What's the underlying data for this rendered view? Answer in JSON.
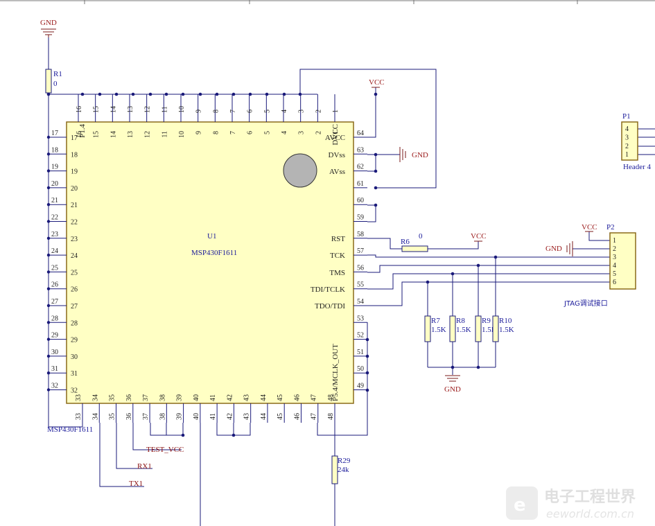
{
  "power": {
    "gnd": "GND",
    "vcc": "VCC"
  },
  "u1": {
    "designator": "U1",
    "part": "MSP430F1611",
    "part_bottom": "MSP430F1611",
    "top_pins": [
      "16",
      "15",
      "14",
      "13",
      "12",
      "11",
      "10",
      "9",
      "8",
      "7",
      "6",
      "5",
      "4",
      "3",
      "2",
      "1"
    ],
    "left_pins": [
      "17",
      "18",
      "19",
      "20",
      "21",
      "22",
      "23",
      "24",
      "25",
      "26",
      "27",
      "28",
      "29",
      "30",
      "31",
      "32"
    ],
    "bottom_pins": [
      "33",
      "34",
      "35",
      "36",
      "37",
      "38",
      "39",
      "40",
      "41",
      "42",
      "43",
      "44",
      "45",
      "46",
      "47",
      "48"
    ],
    "right_pins": [
      "64",
      "63",
      "62",
      "61",
      "60",
      "59",
      "58",
      "57",
      "56",
      "55",
      "54",
      "53",
      "52",
      "51",
      "50",
      "49"
    ],
    "labels": {
      "avcc": "AVCC",
      "dvcc": "DVCC",
      "dvss": "DVss",
      "avss": "AVss",
      "rst": "RST",
      "tck": "TCK",
      "tms": "TMS",
      "tdi": "TDI/TCLK",
      "tdo": "TDO/TDI",
      "p14": "P1.4",
      "p54": "P5.4/MCLK_OUT"
    }
  },
  "resistors": {
    "r1": {
      "ref": "R1",
      "value": "0"
    },
    "r6": {
      "ref": "R6",
      "value": "0"
    },
    "r7": {
      "ref": "R7",
      "value": "1.5K"
    },
    "r8": {
      "ref": "R8",
      "value": "1.5K"
    },
    "r9": {
      "ref": "R9",
      "value": "1.5K"
    },
    "r10": {
      "ref": "R10",
      "value": "1.5K"
    },
    "r29": {
      "ref": "R29",
      "value": "24k"
    }
  },
  "p1": {
    "ref": "P1",
    "label": "Header 4",
    "pins": [
      "4",
      "3",
      "2",
      "1"
    ]
  },
  "p2": {
    "ref": "P2",
    "label": "JTAG调试接口",
    "pins": [
      "1",
      "2",
      "3",
      "4",
      "5",
      "6"
    ]
  },
  "nets": {
    "test_vcc": "TEST_VCC",
    "rx1": "RX1",
    "tx1": "TX1"
  },
  "watermark": {
    "cn": "电子工程世界",
    "en": "eeworld.com.cn"
  }
}
